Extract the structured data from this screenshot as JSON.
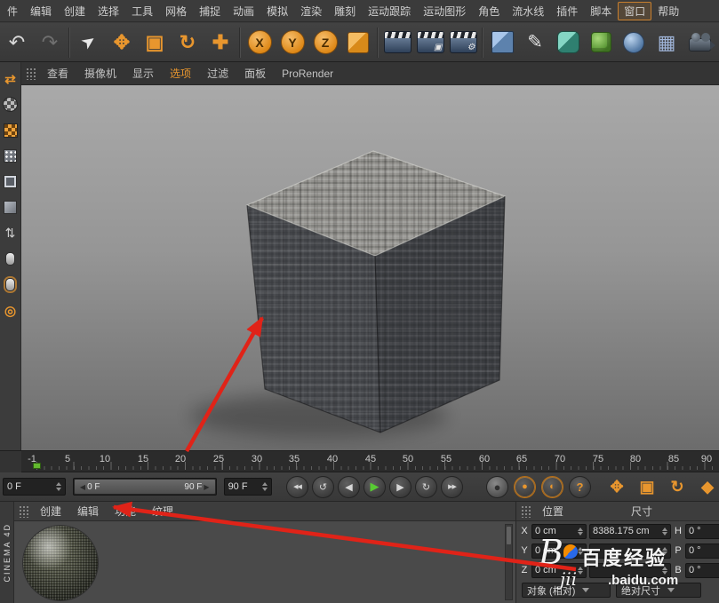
{
  "app": {
    "brand_vertical": "CINEMA 4D"
  },
  "colors": {
    "accent_orange": "#e8962e",
    "play_green": "#58cb33",
    "annotation_red": "#e02318",
    "viewport_top": "#a9a9a9",
    "viewport_bottom": "#6c6c6c"
  },
  "menubar": {
    "items": [
      "件",
      "编辑",
      "创建",
      "选择",
      "工具",
      "网格",
      "捕捉",
      "动画",
      "模拟",
      "渲染",
      "雕刻",
      "运动跟踪",
      "运动图形",
      "角色",
      "流水线",
      "插件",
      "脚本",
      "窗口",
      "帮助"
    ]
  },
  "toolbar": {
    "icons": [
      {
        "name": "undo-icon",
        "glyph": "↶"
      },
      {
        "name": "redo-icon",
        "glyph": "↷"
      },
      {
        "name": "live-selection-icon",
        "glyph": "➤"
      },
      {
        "name": "move-tool-icon",
        "glyph": "✥"
      },
      {
        "name": "scale-tool-icon",
        "glyph": "▣"
      },
      {
        "name": "rotate-tool-icon",
        "glyph": "↻"
      },
      {
        "name": "last-tool-icon",
        "glyph": "✚"
      },
      {
        "name": "lock-x-axis-icon",
        "glyph": "X"
      },
      {
        "name": "lock-y-axis-icon",
        "glyph": "Y"
      },
      {
        "name": "lock-z-axis-icon",
        "glyph": "Z"
      },
      {
        "name": "coordinate-system-icon",
        "glyph": ""
      },
      {
        "name": "render-view-icon",
        "glyph": ""
      },
      {
        "name": "render-picture-viewer-icon",
        "glyph": "▣"
      },
      {
        "name": "render-settings-icon",
        "glyph": "⚙"
      },
      {
        "name": "cube-primitive-icon",
        "glyph": ""
      },
      {
        "name": "pen-tool-icon",
        "glyph": "✎"
      },
      {
        "name": "subdivision-surface-icon",
        "glyph": ""
      },
      {
        "name": "cloner-icon",
        "glyph": ""
      },
      {
        "name": "metaball-icon",
        "glyph": ""
      },
      {
        "name": "floor-icon",
        "glyph": "▦"
      },
      {
        "name": "camera-icon",
        "glyph": ""
      },
      {
        "name": "light-icon",
        "glyph": ""
      }
    ]
  },
  "rail": {
    "icons": [
      {
        "name": "make-editable-icon",
        "glyph": "⇄"
      },
      {
        "name": "model-mode-icon",
        "glyph": ""
      },
      {
        "name": "texture-mode-icon",
        "glyph": ""
      },
      {
        "name": "points-mode-icon",
        "glyph": ""
      },
      {
        "name": "edges-mode-icon",
        "glyph": ""
      },
      {
        "name": "polygons-mode-icon",
        "glyph": ""
      },
      {
        "name": "animation-mode-icon",
        "glyph": "⇅"
      },
      {
        "name": "viewport-solo-icon",
        "glyph": ""
      },
      {
        "name": "lock-workplane-icon",
        "glyph": ""
      },
      {
        "name": "snap-icon",
        "glyph": "◎"
      }
    ]
  },
  "viewport_menu": {
    "items": [
      "查看",
      "摄像机",
      "显示",
      "选项",
      "过滤",
      "面板",
      "ProRender"
    ]
  },
  "timeline": {
    "labels": [
      "-1",
      "5",
      "10",
      "15",
      "20",
      "25",
      "30",
      "35",
      "40",
      "45",
      "50",
      "55",
      "60",
      "65",
      "70",
      "75",
      "80",
      "85",
      "90"
    ],
    "current_frame": 0
  },
  "transport": {
    "current_frame": "0 F",
    "end_frame": "90 F",
    "slider": {
      "start_arrow": "◀",
      "end_arrow": "▶",
      "start": "0 F",
      "end": "90 F"
    },
    "buttons": [
      {
        "name": "go-to-start-button",
        "glyph": "◀◀"
      },
      {
        "name": "play-backwards-button",
        "glyph": "↺"
      },
      {
        "name": "previous-frame-button",
        "glyph": "◀"
      },
      {
        "name": "play-button",
        "glyph": "▶"
      },
      {
        "name": "next-frame-button",
        "glyph": "▶"
      },
      {
        "name": "loop-button",
        "glyph": "↻"
      },
      {
        "name": "go-to-end-button",
        "glyph": "▶▶"
      },
      {
        "name": "record-keyframe-button",
        "glyph": "●"
      },
      {
        "name": "autokey-button",
        "glyph": "●"
      },
      {
        "name": "keyframe-selection-button",
        "glyph": "◐"
      },
      {
        "name": "help-button",
        "glyph": "?"
      },
      {
        "name": "record-position-button",
        "glyph": "✥"
      },
      {
        "name": "record-scale-button",
        "glyph": "▣"
      },
      {
        "name": "record-rotation-button",
        "glyph": "↻"
      },
      {
        "name": "record-parameter-button",
        "glyph": "◆"
      }
    ]
  },
  "materials": {
    "menu_items": [
      "创建",
      "编辑",
      "功能",
      "纹理"
    ]
  },
  "coords": {
    "header_position": "位置",
    "header_size": "尺寸",
    "rows": [
      {
        "axis": "X",
        "position": "0 cm",
        "size": "8388.175 cm",
        "rot_label": "H",
        "rotation": "0 °"
      },
      {
        "axis": "Y",
        "position": "0 cm",
        "size": "",
        "rot_label": "P",
        "rotation": "0 °"
      },
      {
        "axis": "Z",
        "position": "0 cm",
        "size": "",
        "rot_label": "B",
        "rotation": "0 °"
      }
    ],
    "mode_dropdown": "对象 (相对)",
    "size_mode_dropdown": "绝对尺寸"
  },
  "watermark": {
    "initial": "B",
    "brand": "百度经验",
    "script": "jii",
    "domain": ".baidu.com"
  }
}
